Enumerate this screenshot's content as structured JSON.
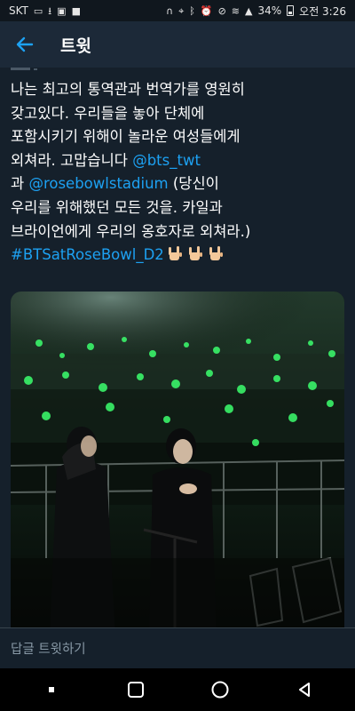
{
  "status_bar": {
    "carrier": "SKT",
    "battery": "34%",
    "clock": "오전 3:26"
  },
  "header": {
    "title": "트윗"
  },
  "tweet": {
    "line1": "나는 최고의 통역관과 번역가를 영원히",
    "line2": "갖고있다. 우리들을 놓아 단체에",
    "line3": "포함시키기 위해이 놀라운 여성들에게",
    "line4_pre": "외쳐라. 고맙습니다 ",
    "mention1": "@bts_twt",
    "line5_pre": "과 ",
    "mention2": "@rosebowlstadium",
    "line5_post": " (당신이",
    "line6": "우리를 위해했던 모든 것을. 카일과",
    "line7": "브라이언에게 우리의 옹호자로 외쳐라.)",
    "hashtag": "#BTSatRoseBowl_D2",
    "emoji": [
      "rock-hand",
      "rock-hand",
      "rock-hand"
    ]
  },
  "media": {
    "alt": "stadium crowd with green lightsticks and sign language interpreters",
    "glow_color": "#3cff6e"
  },
  "reply": {
    "placeholder": "답글 트윗하기"
  },
  "colors": {
    "background": "#15202b",
    "header": "#1c2938",
    "accent": "#1da1f2",
    "muted": "#8899a6"
  }
}
